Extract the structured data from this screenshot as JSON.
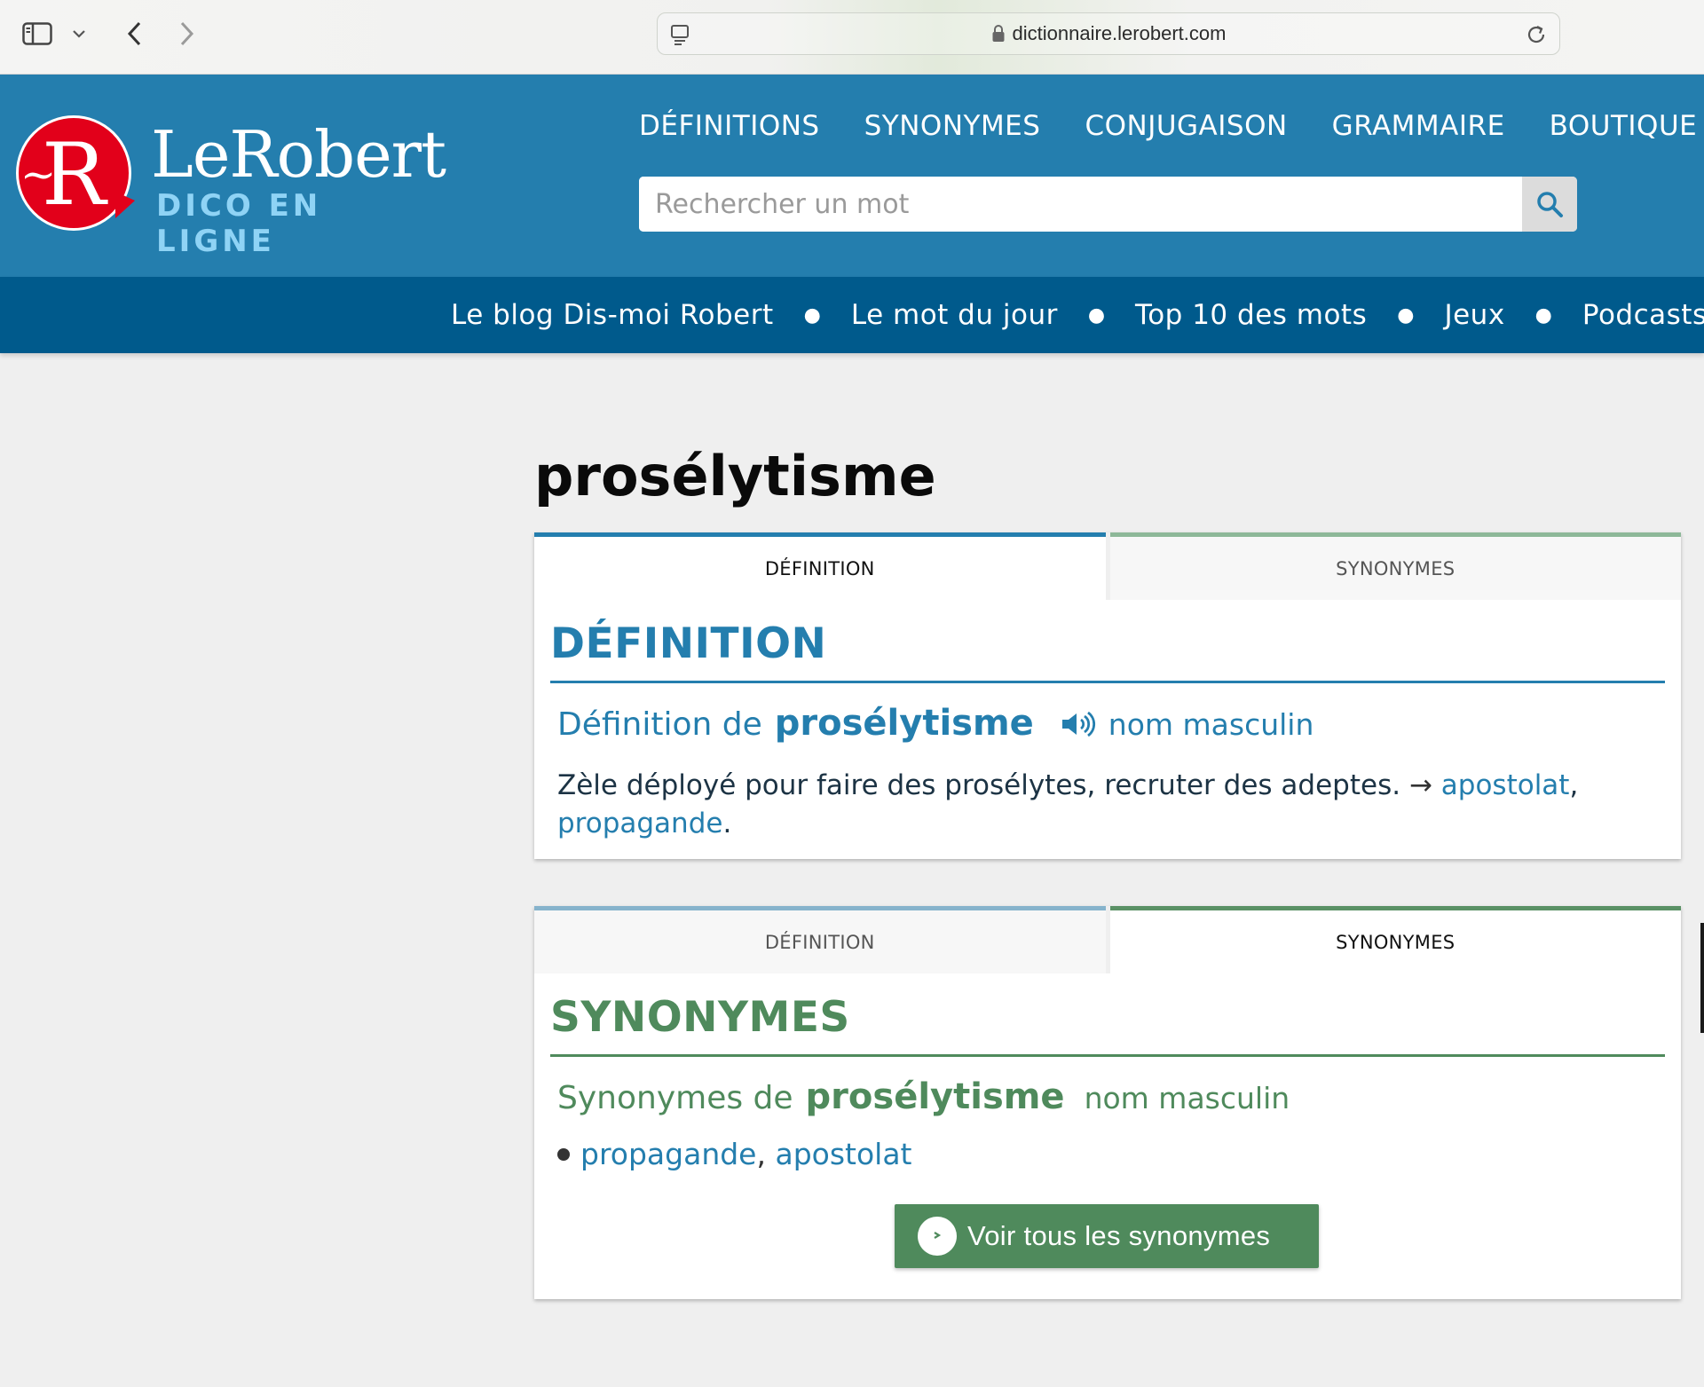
{
  "browser": {
    "url": "dictionnaire.lerobert.com"
  },
  "header": {
    "logo_brand": "LeRobert",
    "logo_sub": "DICO EN LIGNE",
    "logo_letter": "R",
    "logo_tilde": "~",
    "nav": [
      "DÉFINITIONS",
      "SYNONYMES",
      "CONJUGAISON",
      "GRAMMAIRE",
      "BOUTIQUE"
    ],
    "search_placeholder": "Rechercher un mot"
  },
  "sub_nav": [
    "Le blog Dis-moi Robert",
    "Le mot du jour",
    "Top 10 des mots",
    "Jeux",
    "Podcasts et vi"
  ],
  "word": "prosélytisme",
  "tabs": {
    "definition": "DÉFINITION",
    "synonymes": "SYNONYMES"
  },
  "definition_card": {
    "heading": "DÉFINITION",
    "prefix": "Définition de",
    "word": "prosélytisme",
    "pos": "nom masculin",
    "text": "Zèle déployé pour faire des prosélytes, recruter des adeptes.",
    "arrow": "→",
    "links": [
      "apostolat",
      "propagande"
    ],
    "sep": ",",
    "end": "."
  },
  "synonyms_card": {
    "heading": "SYNONYMES",
    "prefix": "Synonymes de",
    "word": "prosélytisme",
    "pos": "nom masculin",
    "synonyms": [
      "propagande",
      "apostolat"
    ],
    "sep": ",",
    "button_label": "Voir tous les synonymes"
  },
  "colors": {
    "header_blue": "#247eae",
    "subnav_blue": "#005a8c",
    "synonym_green": "#4f8a5c",
    "logo_red": "#e2001a",
    "logo_light_blue": "#8fd3f5"
  },
  "icons": {
    "sidebar": "sidebar-icon",
    "back": "chevron-left-icon",
    "forward": "chevron-right-icon",
    "lock": "lock-icon",
    "reload": "reload-icon",
    "search": "search-icon",
    "speaker": "speaker-icon"
  }
}
